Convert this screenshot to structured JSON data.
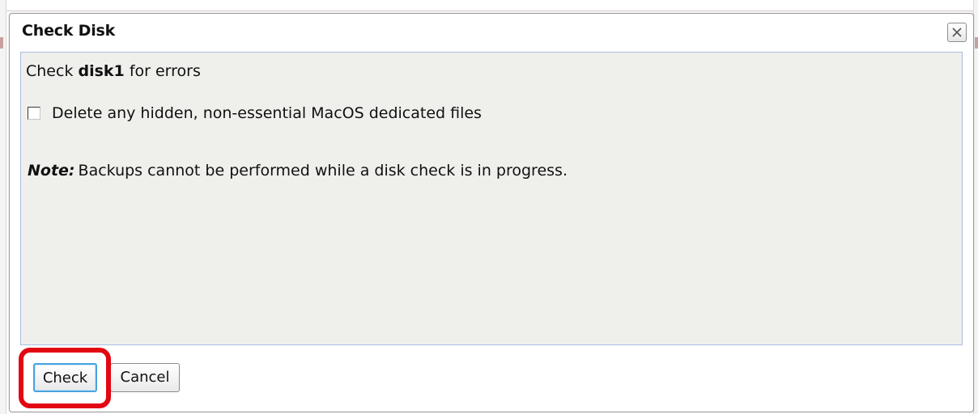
{
  "dialog": {
    "title": "Check Disk",
    "close_label": "close",
    "message": {
      "prefix": "Check ",
      "disk_name": "disk1",
      "suffix": " for errors"
    },
    "option": {
      "label": "Delete any hidden, non-essential MacOS dedicated files",
      "checked": false
    },
    "note": {
      "label": "Note:",
      "text": "Backups cannot be performed while a disk check is in progress."
    },
    "buttons": {
      "check_label": "Check",
      "cancel_label": "Cancel"
    }
  },
  "colors": {
    "highlight": "#e30613",
    "focus_border": "#4aa3df",
    "panel_background": "#efefec",
    "panel_border": "#a9bde0"
  }
}
